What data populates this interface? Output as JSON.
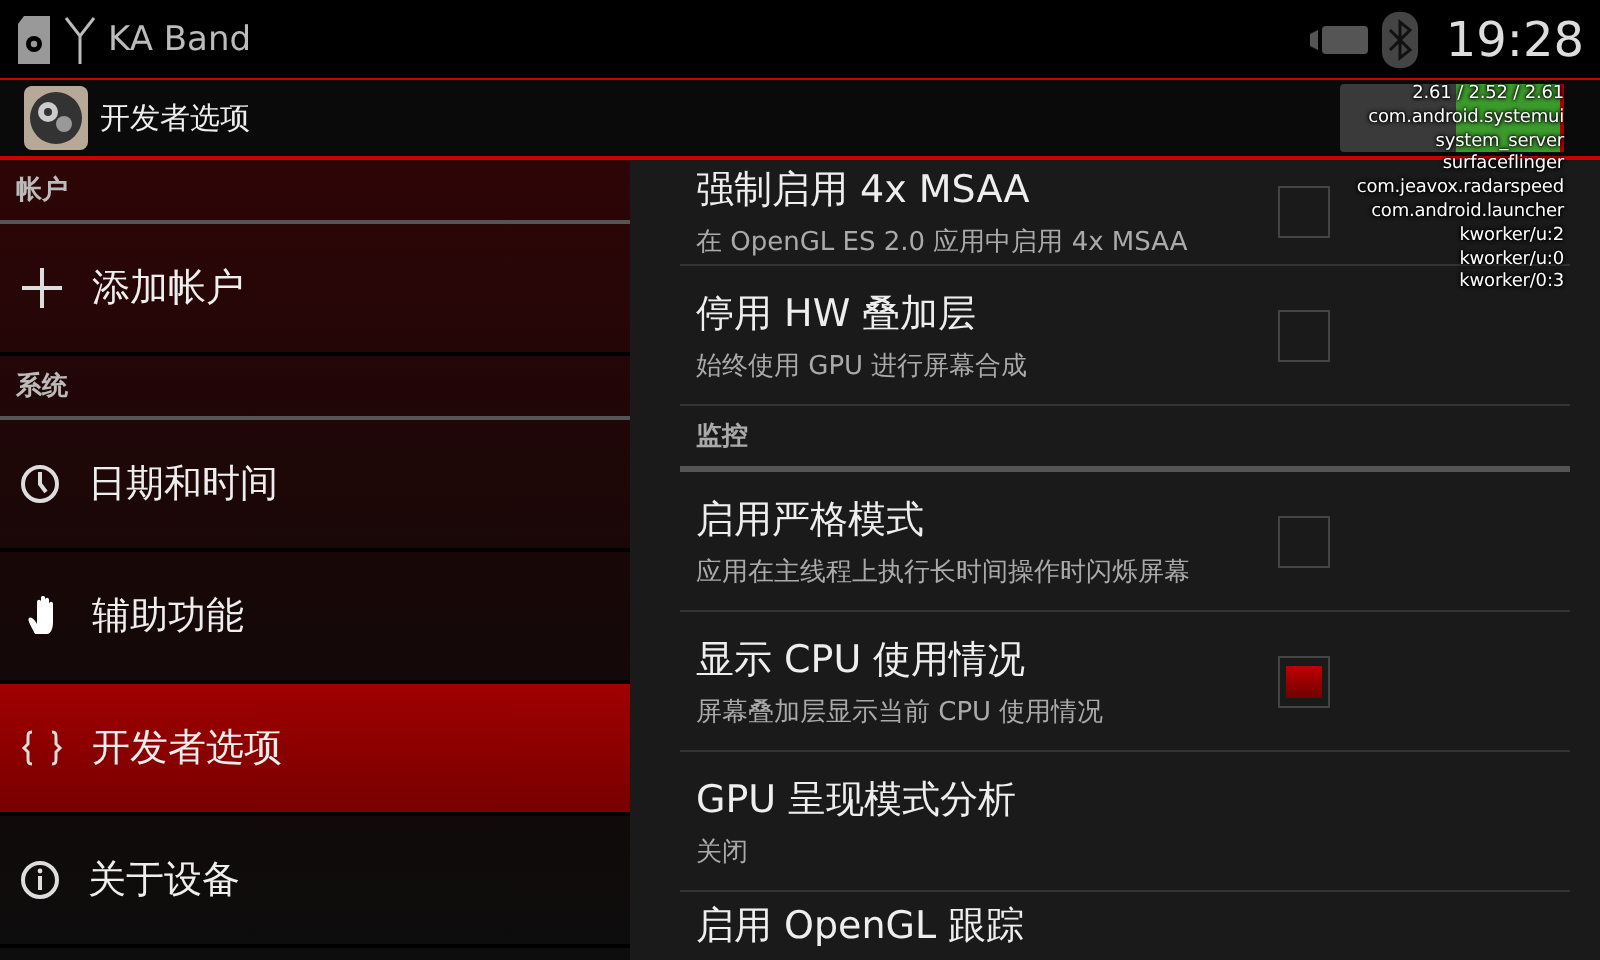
{
  "status_bar": {
    "carrier": "KA Band",
    "time": "19:28"
  },
  "action_bar": {
    "title": "开发者选项"
  },
  "sidebar": {
    "sections": [
      {
        "header": "帐户",
        "items": [
          {
            "label": "添加帐户",
            "selected": false
          }
        ]
      },
      {
        "header": "系统",
        "items": [
          {
            "label": "日期和时间",
            "selected": false
          },
          {
            "label": "辅助功能",
            "selected": false
          },
          {
            "label": "开发者选项",
            "selected": true
          },
          {
            "label": "关于设备",
            "selected": false
          }
        ]
      }
    ]
  },
  "settings": [
    {
      "kind": "checkbox",
      "title": "强制启用 4x MSAA",
      "summary": "在 OpenGL ES 2.0 应用中启用 4x MSAA",
      "checked": false
    },
    {
      "kind": "checkbox",
      "title": "停用 HW 叠加层",
      "summary": "始终使用 GPU 进行屏幕合成",
      "checked": false
    },
    {
      "kind": "header",
      "title": "监控"
    },
    {
      "kind": "checkbox",
      "title": "启用严格模式",
      "summary": "应用在主线程上执行长时间操作时闪烁屏幕",
      "checked": false
    },
    {
      "kind": "checkbox",
      "title": "显示 CPU 使用情况",
      "summary": "屏幕叠加层显示当前 CPU 使用情况",
      "checked": true
    },
    {
      "kind": "plain",
      "title": "GPU 呈现模式分析",
      "summary": "关闭"
    },
    {
      "kind": "plain",
      "title": "启用 OpenGL 跟踪"
    }
  ],
  "cpu_overlay": {
    "lines": [
      "2.61 / 2.52 / 2.61",
      "com.android.systemui",
      "system_server",
      "surfaceflinger",
      "com.jeavox.radarspeed",
      "com.android.launcher",
      "kworker/u:2",
      "kworker/u:0",
      "kworker/0:3"
    ]
  }
}
